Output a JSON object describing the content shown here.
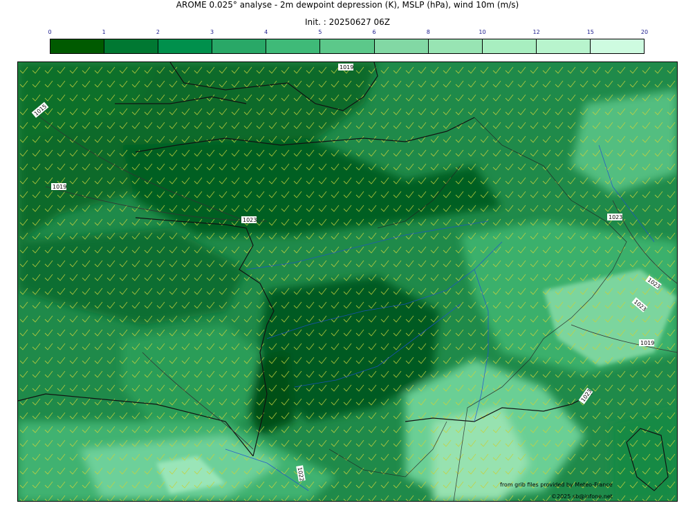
{
  "header": {
    "title": "AROME 0.025° analyse - 2m dewpoint depression (K), MSLP (hPa), wind 10m (m/s)",
    "init": "Init. : 20250627 06Z"
  },
  "colorbar": {
    "ticks": [
      "0",
      "1",
      "2",
      "3",
      "4",
      "5",
      "6",
      "8",
      "10",
      "12",
      "15",
      "20"
    ],
    "colors": [
      "#005a00",
      "#007832",
      "#00904c",
      "#29a867",
      "#3fba78",
      "#5cc88a",
      "#82d8a4",
      "#98e4b3",
      "#a8eec0",
      "#b8f4cd",
      "#cefbe0"
    ]
  },
  "isobars": {
    "labels": [
      "1019",
      "1015",
      "1019",
      "1023",
      "1023",
      "1023",
      "1023",
      "1023",
      "1019",
      "1023",
      "1022"
    ]
  },
  "credits": {
    "source": "from grib files provided by Meteo-France",
    "copyright": "©2025 sb@infone.net"
  }
}
